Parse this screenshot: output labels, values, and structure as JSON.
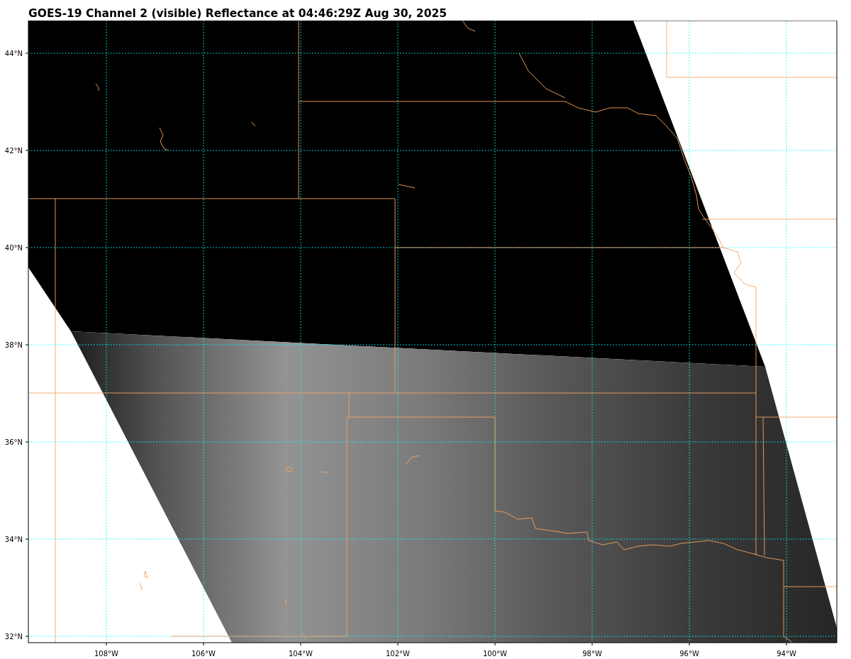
{
  "title": "GOES-19 Channel 2 (visible) Reflectance at 04:46:29Z Aug 30, 2025",
  "latitude_labels": [
    "44°N",
    "42°N",
    "40°N",
    "38°N",
    "36°N",
    "34°N",
    "32°N"
  ],
  "longitude_labels": [
    "108°W",
    "106°W",
    "104°W",
    "102°W",
    "100°W",
    "98°W",
    "96°W",
    "94°W"
  ]
}
